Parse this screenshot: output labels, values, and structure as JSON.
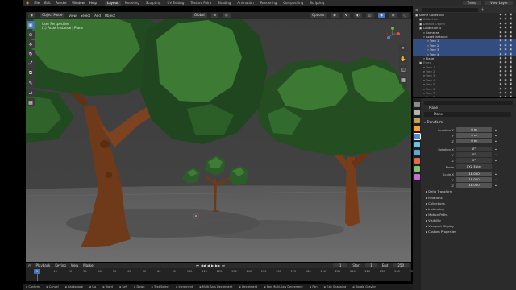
{
  "topbar": {
    "menus": [
      "File",
      "Edit",
      "Render",
      "Window",
      "Help"
    ],
    "workspaces": [
      "Layout",
      "Modeling",
      "Sculpting",
      "UV Editing",
      "Texture Paint",
      "Shading",
      "Animation",
      "Rendering",
      "Compositing",
      "Scripting"
    ],
    "active_workspace": "Layout",
    "scene": "Trees",
    "view_layer": "View Layer"
  },
  "viewport": {
    "mode": "Object Mode",
    "menus": [
      "View",
      "Select",
      "Add",
      "Object"
    ],
    "orientation": "Global",
    "options": "Options",
    "overlay_line1": "User Perspective",
    "overlay_line2": "(1) Asset Instance | Plane"
  },
  "toolbar": {
    "tools": [
      "select-box",
      "cursor",
      "move",
      "rotate",
      "scale",
      "transform",
      "annotate",
      "measure",
      "add-cube"
    ],
    "icon_glyphs": [
      "▣",
      "⊕",
      "✥",
      "↻",
      "⤢",
      "⧉",
      "✎",
      "⊿",
      "▦"
    ],
    "active": 0
  },
  "outliner": {
    "rows": [
      {
        "label": "Scene Collection",
        "indent": 0,
        "selected": false,
        "dim": false
      },
      {
        "label": "Collection",
        "indent": 1,
        "selected": false,
        "dim": true
      },
      {
        "label": "Default Object",
        "indent": 1,
        "selected": false,
        "dim": true
      },
      {
        "label": "Collection 4",
        "indent": 1,
        "selected": false,
        "dim": false
      },
      {
        "label": "Cameras",
        "indent": 2,
        "selected": false,
        "dim": false
      },
      {
        "label": "Asset Instance",
        "indent": 2,
        "selected": false,
        "dim": false
      },
      {
        "label": "Tree 1",
        "indent": 3,
        "selected": true,
        "dim": false
      },
      {
        "label": "Tree 2",
        "indent": 3,
        "selected": true,
        "dim": false
      },
      {
        "label": "Tree 3",
        "indent": 3,
        "selected": true,
        "dim": false
      },
      {
        "label": "Tree 4",
        "indent": 3,
        "selected": true,
        "dim": false
      },
      {
        "label": "Plane",
        "indent": 2,
        "selected": false,
        "dim": false
      },
      {
        "label": "Trees",
        "indent": 1,
        "selected": false,
        "dim": true
      },
      {
        "label": "Tree 1",
        "indent": 2,
        "selected": false,
        "dim": true
      },
      {
        "label": "Tree 2",
        "indent": 2,
        "selected": false,
        "dim": true
      },
      {
        "label": "Tree 3",
        "indent": 2,
        "selected": false,
        "dim": true
      },
      {
        "label": "Tree 4",
        "indent": 2,
        "selected": false,
        "dim": true
      },
      {
        "label": "Tree 5",
        "indent": 2,
        "selected": false,
        "dim": true
      },
      {
        "label": "Tree 6",
        "indent": 2,
        "selected": false,
        "dim": true
      },
      {
        "label": "Tree 7",
        "indent": 2,
        "selected": false,
        "dim": true
      },
      {
        "label": "Tree 8",
        "indent": 2,
        "selected": false,
        "dim": true
      }
    ],
    "vis_icons": "◉ ◉ ▣"
  },
  "properties": {
    "object_name": "Plane",
    "object_field": "Plane",
    "transform_title": "Transform",
    "location_label": "Location X",
    "rotation_label": "Rotation X",
    "mode_label": "Mode",
    "scale_label": "Scale X",
    "y_label": "Y",
    "z_label": "Z",
    "location": [
      "0 m",
      "0 m",
      "0 m"
    ],
    "rotation": [
      "0°",
      "0°",
      "0°"
    ],
    "rotation_mode": "XYZ Euler",
    "scale": [
      "18.000",
      "18.000",
      "18.000"
    ],
    "delta_transform": "Delta Transform",
    "sections": [
      "Relations",
      "Collections",
      "Instancing",
      "Motion Paths",
      "Visibility",
      "Viewport Display",
      "Custom Properties"
    ],
    "tab_colors": [
      "#8a8a8a",
      "#b3b3b3",
      "#c6a05a",
      "#ff9a3c",
      "#4f8ad1",
      "#6cc0e5",
      "#5aa9d9",
      "#e06a4a",
      "#7cc46e",
      "#c86fd1"
    ],
    "accent": "#4772b3"
  },
  "timeline": {
    "menus": [
      "Playback",
      "Keying",
      "View",
      "Marker"
    ],
    "current_frame": "1",
    "start_label": "Start",
    "start": "1",
    "end_label": "End",
    "end": "250",
    "ticks": [
      "10",
      "20",
      "30",
      "40",
      "50",
      "60",
      "70",
      "80",
      "90",
      "100",
      "110",
      "120",
      "130",
      "140",
      "150",
      "160",
      "170",
      "180",
      "190",
      "200",
      "210",
      "220",
      "230",
      "240",
      "250"
    ],
    "tick0": "1"
  },
  "status": {
    "items": [
      "Confirm",
      "Cancel",
      "Backspace",
      "Up",
      "Right",
      "Left",
      "Down",
      "Text Select",
      "Increment",
      "Multi-Axis Decrement",
      "Decrement",
      "Pan Multi-Axis Decrement",
      "Pan",
      "Exit Snapping",
      "Toggle Gravity"
    ]
  }
}
